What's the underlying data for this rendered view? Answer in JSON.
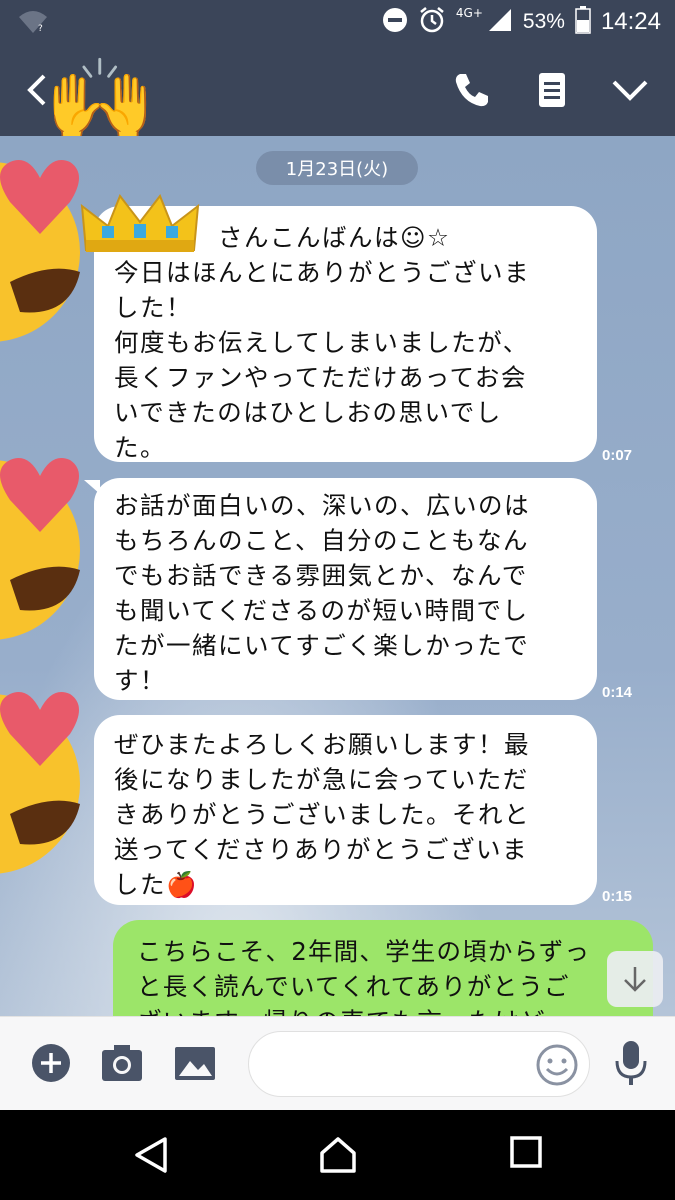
{
  "status_bar": {
    "network_label": "4G+",
    "battery": "53%",
    "time": "14:24",
    "icons": [
      "wifi-icon",
      "do-not-disturb-icon",
      "alarm-icon",
      "signal-icon",
      "battery-icon"
    ]
  },
  "header": {
    "icons": [
      "back-icon",
      "phone-icon",
      "notes-icon",
      "chevron-down-icon"
    ],
    "sticker": "raised-hands"
  },
  "chat": {
    "date": "1月23日(火)",
    "messages": [
      {
        "side": "received",
        "text": "　　　　さんこんばんは☺☆\n今日はほんとにありがとうございま\nした！\n何度もお伝えしてしまいましたが、\n長くファンやってただけあってお会\nいできたのはひとしおの思いでし\nた。",
        "time": "0:07"
      },
      {
        "side": "received",
        "text": "お話が面白いの、深いの、広いのは\nもちろんのこと、自分のこともなん\nでもお話できる雰囲気とか、なんで\nも聞いてくださるのが短い時間でし\nたが一緒にいてすごく楽しかったで\nす！",
        "time": "0:14"
      },
      {
        "side": "received",
        "text": "ぜひまたよろしくお願いします！最\n後になりましたが急に会っていただ\nきありがとうございました。それと\n送ってくださりありがとうございま\nした🍎",
        "time": "0:15"
      },
      {
        "side": "sent",
        "text": "こちらこそ、2年間、学生の頃からずっ\nと長く読んでいてくれてありがとうご\nざいます。帰りの車でも言ったけど、"
      }
    ]
  },
  "input_bar": {
    "icons": [
      "add-icon",
      "camera-icon",
      "image-icon",
      "emoji-icon",
      "microphone-icon"
    ],
    "message_value": ""
  },
  "nav_bar": {
    "icons": [
      "back-triangle-icon",
      "home-icon",
      "recents-icon"
    ]
  },
  "colors": {
    "header_bg": "#3b4559",
    "chat_bg": "#8ea6c4",
    "sent_bubble": "#9ce569",
    "received_bubble": "#ffffff"
  }
}
